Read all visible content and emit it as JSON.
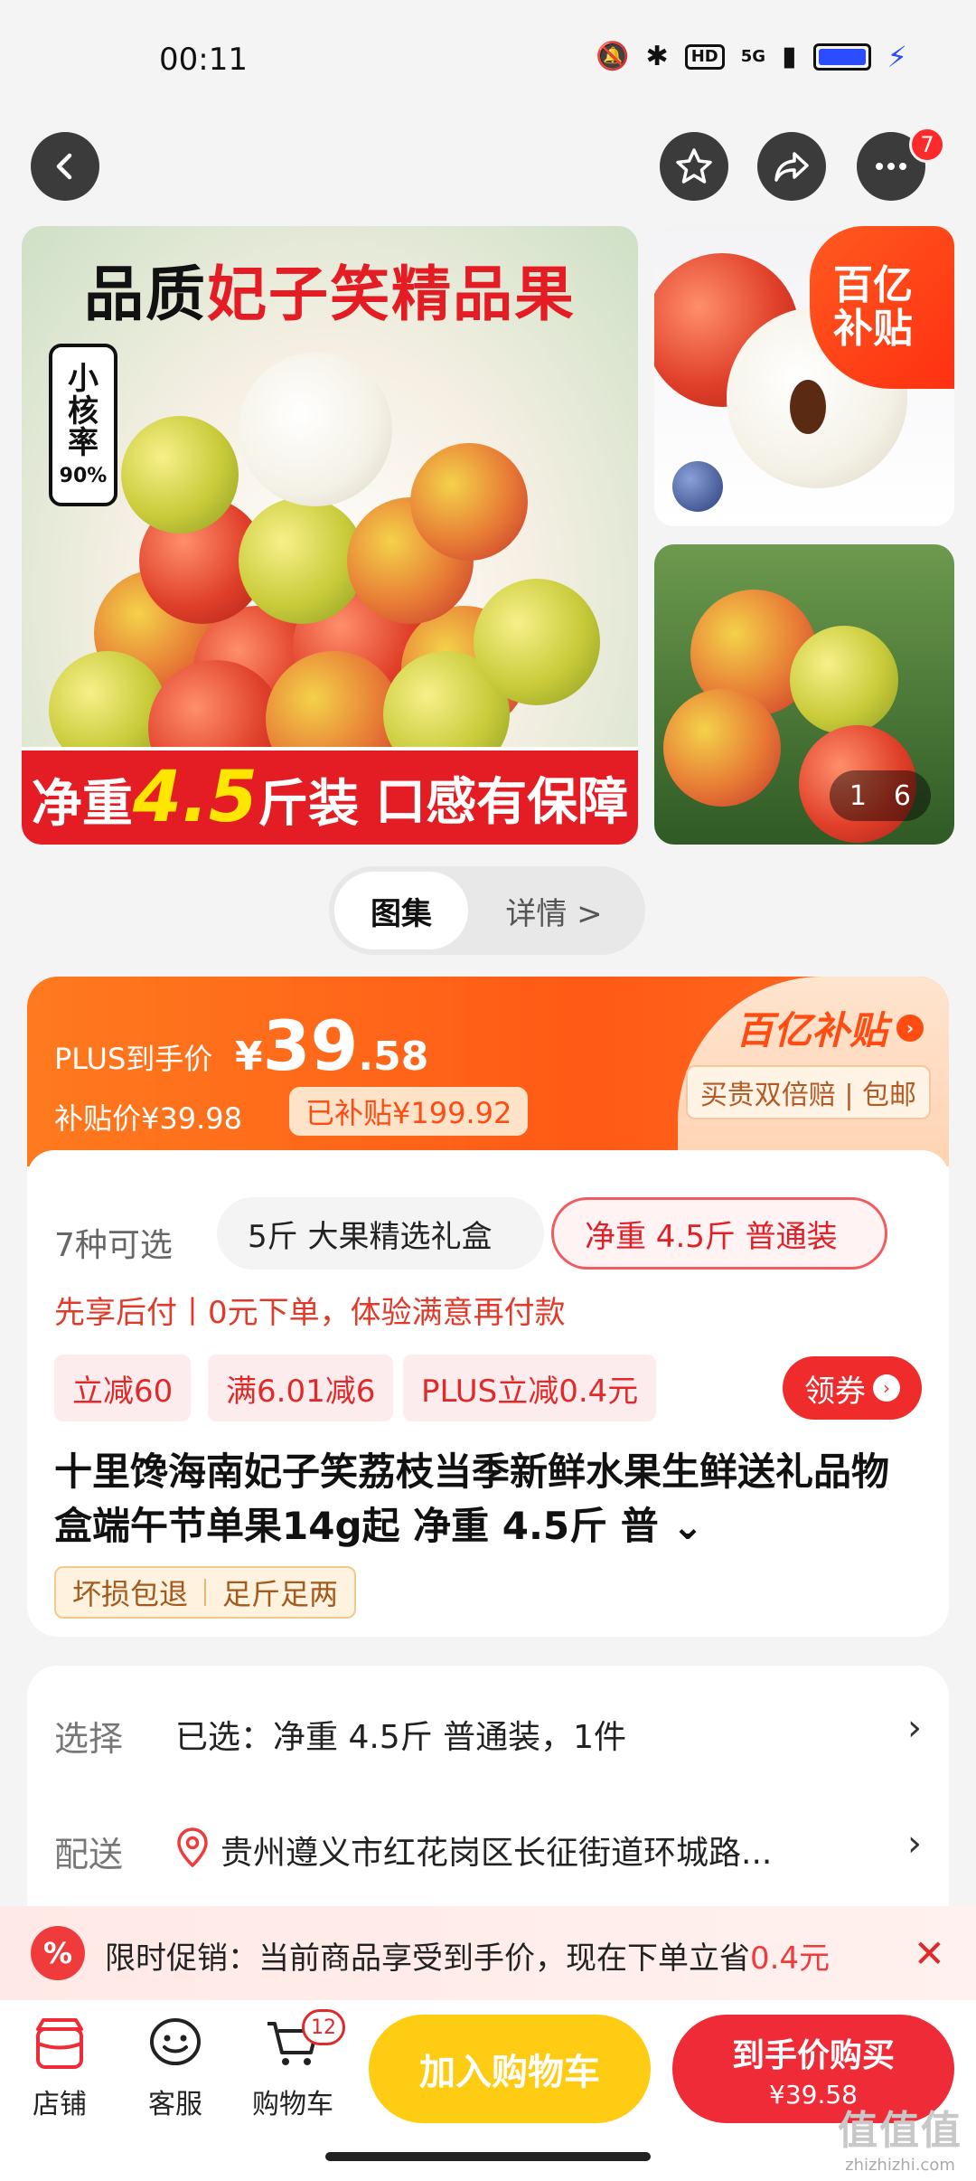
{
  "status_bar": {
    "time": "00:11",
    "hd": "HD",
    "network": "5G"
  },
  "nav": {
    "more_badge": "7"
  },
  "gallery": {
    "title_black": "品质",
    "title_red": "妃子笑精品果",
    "core_badge": [
      "小",
      "核",
      "率"
    ],
    "core_badge_pct": "90%",
    "bottom_banner_pre": "净重",
    "bottom_banner_big": "4.5",
    "bottom_banner_post": "斤装",
    "bottom_banner_right": "口感有保障",
    "corner_badge_line1": "百亿",
    "corner_badge_line2": "补贴",
    "page_current": "1",
    "page_total": "6"
  },
  "tabs": {
    "gallery": "图集",
    "details": "详情 >"
  },
  "price": {
    "plus_label": "PLUS到手价",
    "currency": "¥",
    "integer": "39",
    "decimal": ".58",
    "subsidy_price": "补贴价¥39.98",
    "subsidized": "已补贴¥199.92",
    "yi_logo": "百亿补贴",
    "guarantee": "买贵双倍赔 | 包邮"
  },
  "variants": {
    "count_label": "7种可选",
    "option_1": "5斤 大果精选礼盒",
    "option_2": "净重 4.5斤 普通装"
  },
  "pay_later": "先享后付丨0元下单，体验满意再付款",
  "coupons": [
    "立减60",
    "满6.01减6",
    "PLUS立减0.4元"
  ],
  "get_coupon": "领券",
  "product_title": "十里馋海南妃子笑荔枝当季新鲜水果生鲜送礼品物盒端午节单果14g起 净重 4.5斤 普",
  "product_title_expand": "⌄",
  "tags": [
    "坏损包退",
    "足斤足两"
  ],
  "selection": {
    "select_label": "选择",
    "select_value": "已选：净重 4.5斤 普通装，1件",
    "delivery_label": "配送",
    "delivery_value": "贵州遵义市红花岗区长征街道环城路..."
  },
  "promo_notice": {
    "icon": "%",
    "text": "限时促销：当前商品享受到手价，现在下单立省",
    "amount": "0.4元"
  },
  "bottom_bar": {
    "shop": "店铺",
    "service": "客服",
    "cart": "购物车",
    "cart_badge": "12",
    "add_to_cart": "加入购物车",
    "buy_now": "到手价购买",
    "buy_price": "¥39.58"
  },
  "watermark": {
    "main": "值值值",
    "url": "zhizhizhi.com"
  },
  "colors": {
    "accent_red": "#ef2b38",
    "accent_orange": "#ff5a16",
    "cart_yellow": "#ffcc14"
  }
}
